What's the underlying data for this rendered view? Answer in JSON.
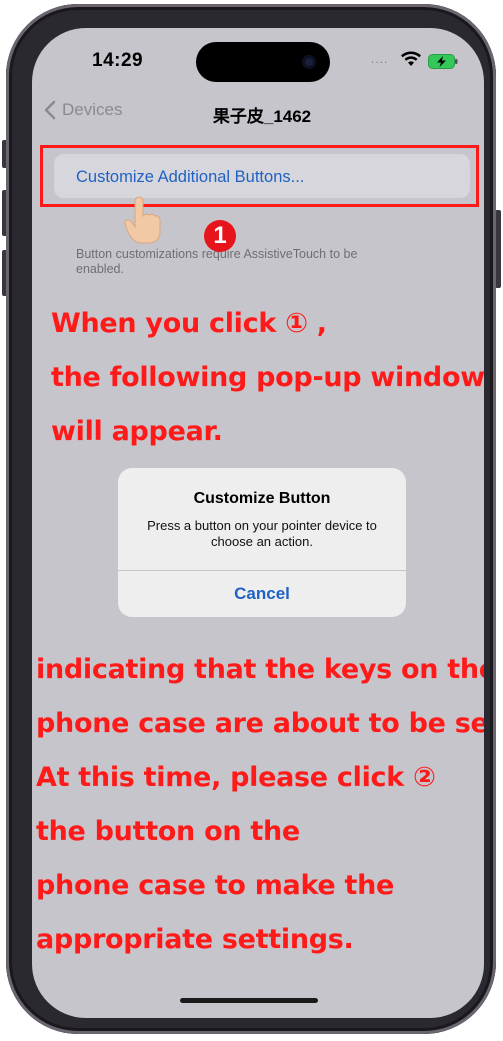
{
  "status_bar": {
    "time": "14:29",
    "signal": "....",
    "wifi_icon": "wifi-icon",
    "battery_icon": "battery-charging-icon",
    "battery_color": "#34c759"
  },
  "nav": {
    "back_label": "Devices",
    "title": "果子皮_1462"
  },
  "settings": {
    "row_label": "Customize Additional Buttons...",
    "footnote": "Button customizations require AssistiveTouch to be enabled."
  },
  "annotation": {
    "marker_1": "1",
    "highlight_color": "#ff1a1a",
    "lines_top": [
      "When you click ① ,",
      "the following pop-up window",
      "will appear."
    ],
    "lines_bottom": [
      "indicating that the keys on the",
      "phone case are about to be set,",
      "At this time, please click ②",
      "the  button on the",
      "phone case to make the",
      "appropriate settings."
    ]
  },
  "alert": {
    "title": "Customize Button",
    "message": "Press a button on your pointer device to choose an action.",
    "cancel_label": "Cancel"
  },
  "colors": {
    "link_blue": "#1f62c4",
    "screen_bg": "#c6c5cb",
    "annotation_red": "#ff1a1a"
  }
}
